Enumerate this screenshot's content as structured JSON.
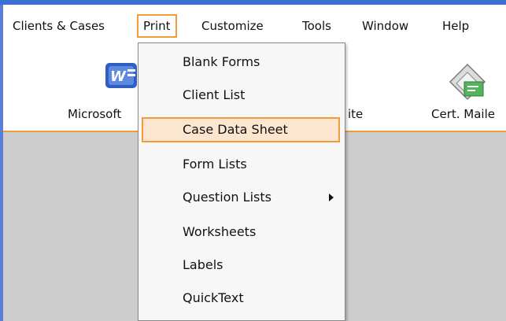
{
  "menubar": {
    "items": [
      "Clients & Cases",
      "Print",
      "Customize",
      "Tools",
      "Window",
      "Help"
    ]
  },
  "toolbar": {
    "buttons": [
      {
        "label": "Microsoft",
        "icon": "word-icon"
      },
      {
        "label": "ite",
        "icon": null
      },
      {
        "label": "Cert. Maile",
        "icon": "certified-mail-icon"
      }
    ]
  },
  "print_menu": {
    "items": [
      {
        "label": "Blank Forms",
        "has_submenu": false,
        "highlighted": false
      },
      {
        "label": "Client List",
        "has_submenu": false,
        "highlighted": false
      },
      {
        "label": "Case Data Sheet",
        "has_submenu": false,
        "highlighted": true
      },
      {
        "label": "Form Lists",
        "has_submenu": false,
        "highlighted": false
      },
      {
        "label": "Question Lists",
        "has_submenu": true,
        "highlighted": false
      },
      {
        "label": "Worksheets",
        "has_submenu": false,
        "highlighted": false
      },
      {
        "label": "Labels",
        "has_submenu": false,
        "highlighted": false
      },
      {
        "label": "QuickText",
        "has_submenu": false,
        "highlighted": false
      }
    ]
  },
  "colors": {
    "accent": "#f39a3a",
    "highlight_fill": "#fde6cf",
    "title_blue": "#3b6fd1"
  }
}
